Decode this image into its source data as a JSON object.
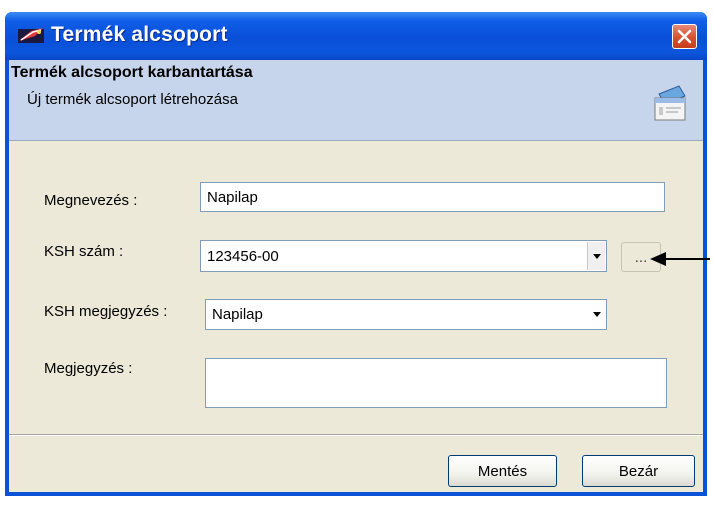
{
  "window": {
    "title": "Termék alcsoport",
    "icons": {
      "app": "app-icon",
      "close": "close-icon"
    }
  },
  "header": {
    "title": "Termék alcsoport karbantartása",
    "subtitle": "Új termék alcsoport létrehozása",
    "icon": "window-form-icon"
  },
  "form": {
    "name_label": "Megnevezés :",
    "name_value": "Napilap",
    "ksh_label": "KSH szám :",
    "ksh_value": "123456-00",
    "browse_label": "...",
    "ksh_note_label": "KSH megjegyzés :",
    "ksh_note_value": "Napilap",
    "note_label": "Megjegyzés :",
    "note_value": ""
  },
  "buttons": {
    "save": "Mentés",
    "close": "Bezár"
  },
  "colors": {
    "titlebar": "#0a4fd8",
    "header_band": "#c6d5ec",
    "dialog_bg": "#ece9d8",
    "close_button": "#d8502f"
  }
}
